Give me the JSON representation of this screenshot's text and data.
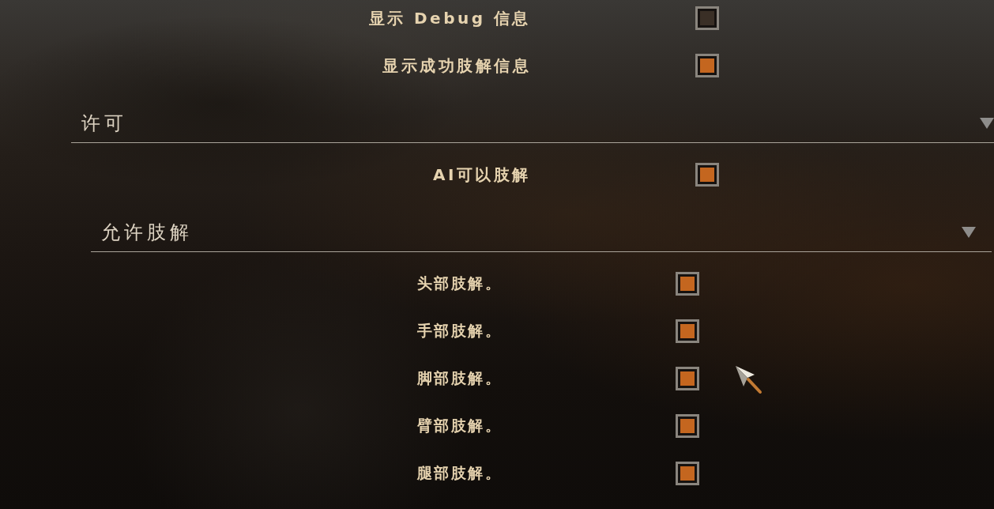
{
  "settings": [
    {
      "label": "显示 Debug 信息",
      "checked": false
    },
    {
      "label": "显示成功肢解信息",
      "checked": true
    }
  ],
  "sections": [
    {
      "title": "许可",
      "expanded": true,
      "children": [
        {
          "kind": "checkbox",
          "label": "AI可以肢解",
          "checked": true
        },
        {
          "kind": "group",
          "title": "允许肢解",
          "expanded": true,
          "children": [
            {
              "kind": "checkbox",
              "label": "头部肢解。",
              "checked": true
            },
            {
              "kind": "checkbox",
              "label": "手部肢解。",
              "checked": true
            },
            {
              "kind": "checkbox",
              "label": "脚部肢解。",
              "checked": true
            },
            {
              "kind": "checkbox",
              "label": "臂部肢解。",
              "checked": true
            },
            {
              "kind": "checkbox",
              "label": "腿部肢解。",
              "checked": true
            }
          ]
        }
      ]
    }
  ]
}
